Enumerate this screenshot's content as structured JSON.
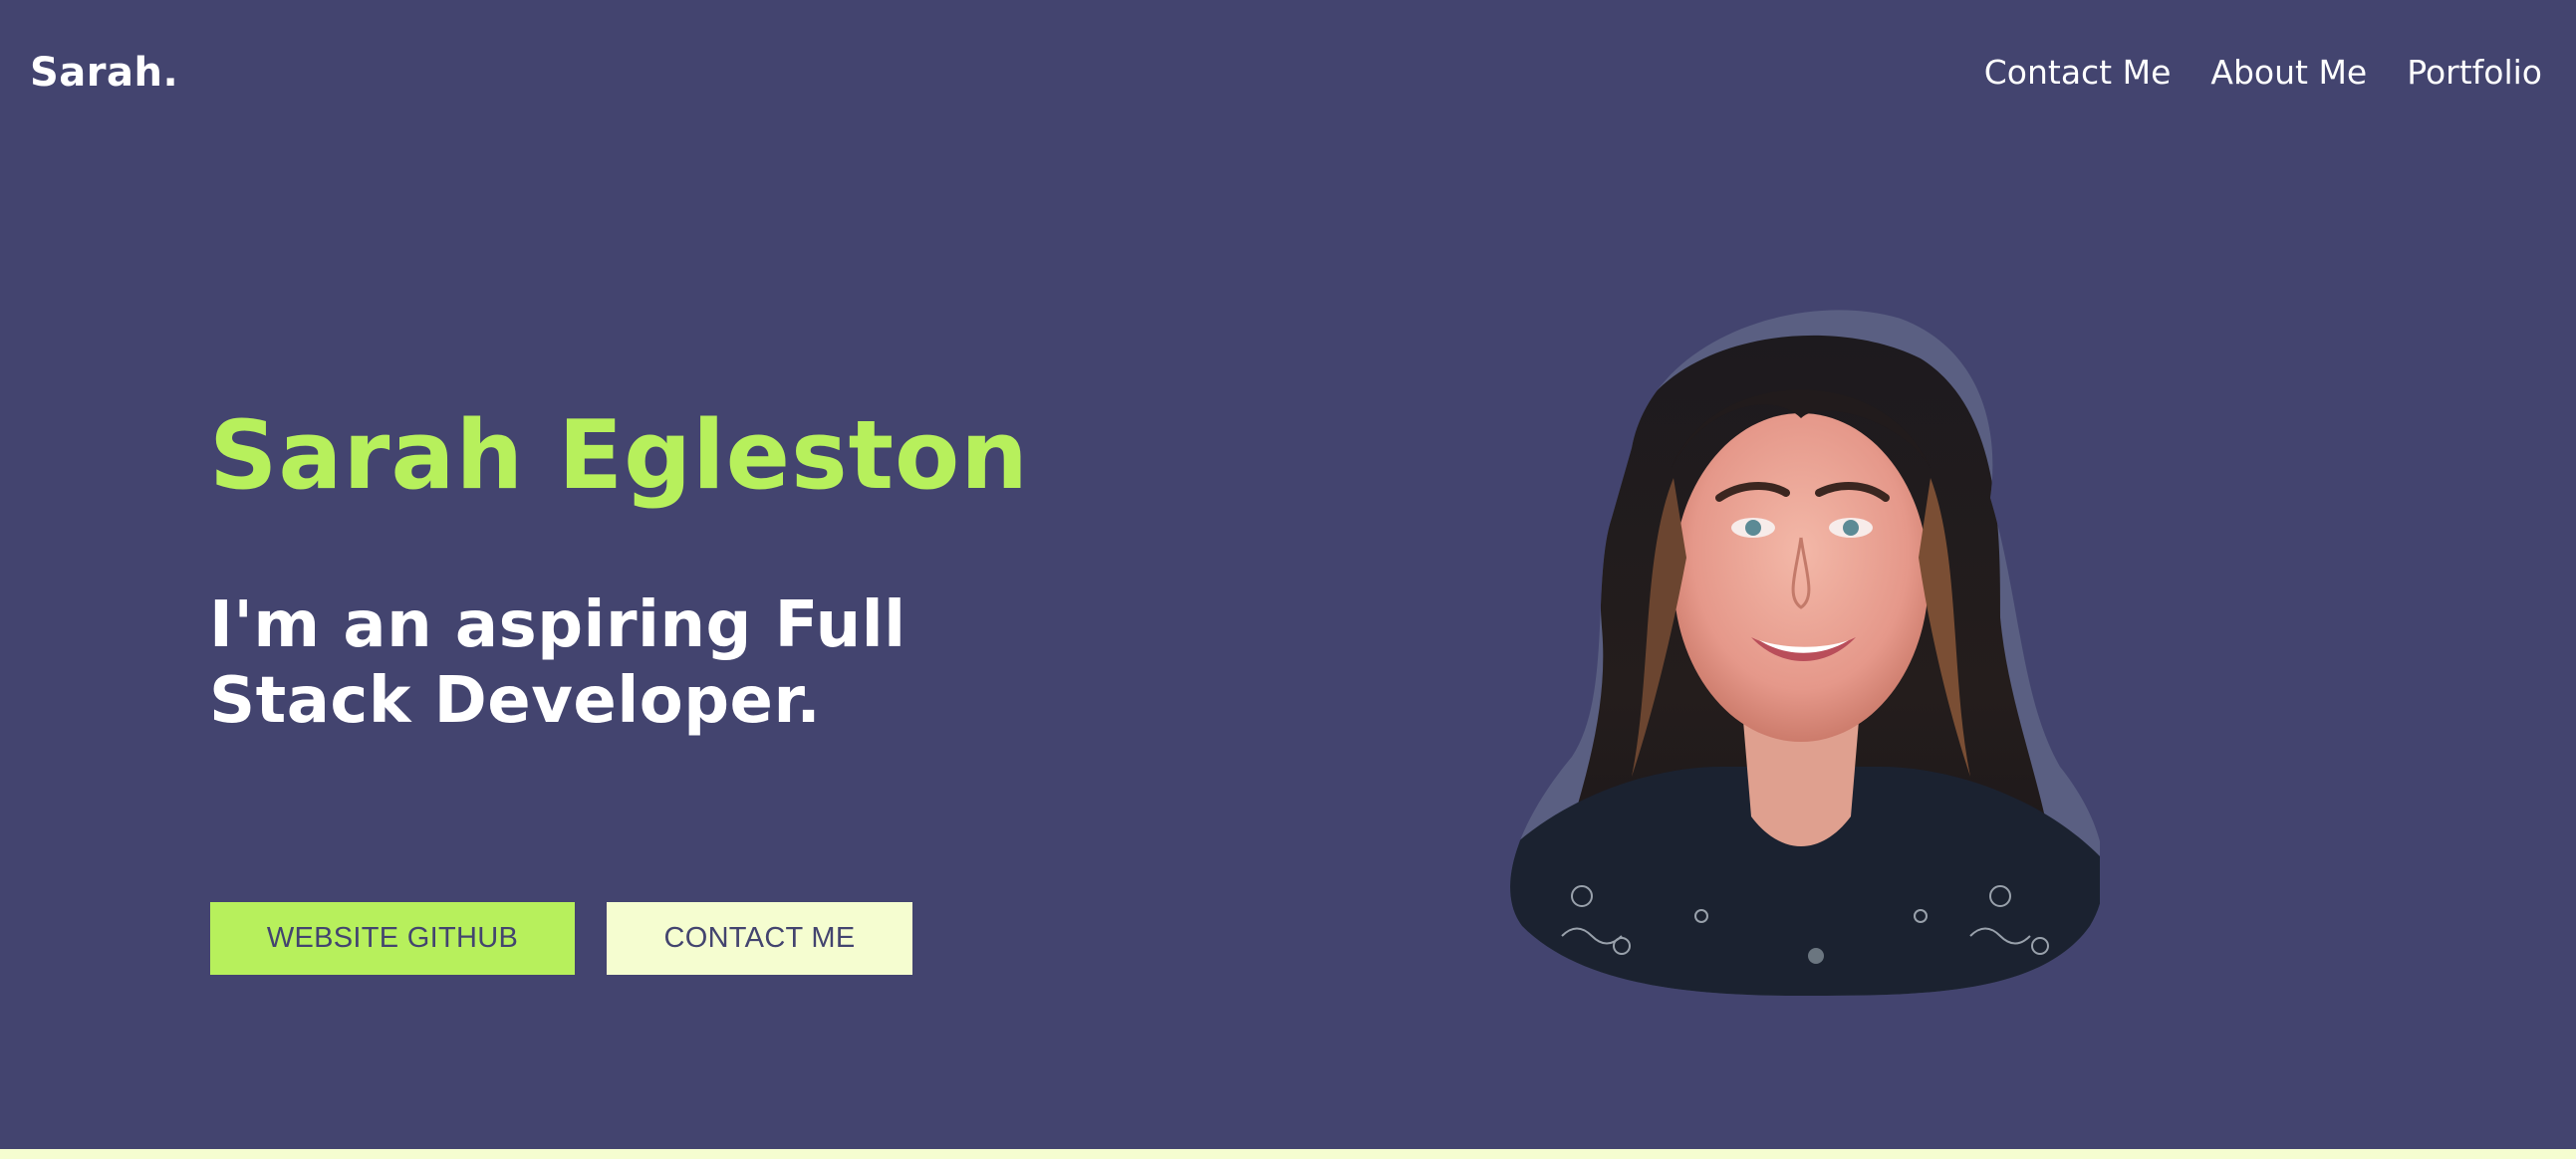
{
  "nav": {
    "logo": "Sarah.",
    "links": [
      {
        "label": "Contact Me"
      },
      {
        "label": "About Me"
      },
      {
        "label": "Portfolio"
      }
    ]
  },
  "hero": {
    "name": "Sarah Egleston",
    "tagline": "I'm an aspiring Full Stack Developer.",
    "buttons": {
      "github": "WEBSITE GITHUB",
      "contact": "CONTACT ME"
    },
    "portrait": "portrait-photo"
  },
  "colors": {
    "background": "#43446f",
    "accent": "#b7f05c",
    "light": "#f5fdd0",
    "text": "#ffffff"
  }
}
